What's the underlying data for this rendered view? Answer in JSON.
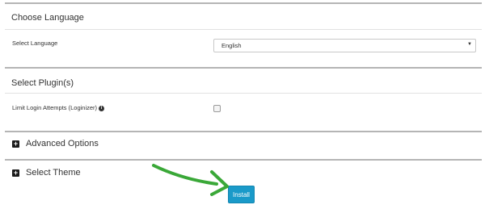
{
  "language_section": {
    "title": "Choose Language",
    "field_label": "Select Language",
    "selected_value": "English"
  },
  "plugins_section": {
    "title": "Select Plugin(s)",
    "plugin_label": "Limit Login Attempts (Loginizer)",
    "plugin_checked": false
  },
  "advanced_section": {
    "title": "Advanced Options"
  },
  "theme_section": {
    "title": "Select Theme"
  },
  "install_button": {
    "label": "Install"
  },
  "colors": {
    "install_bg": "#1a9ac9",
    "arrow": "#3aa838"
  },
  "icons": {
    "info": "info-circle-icon",
    "expand": "plus-square-icon",
    "caret": "caret-down-icon"
  }
}
